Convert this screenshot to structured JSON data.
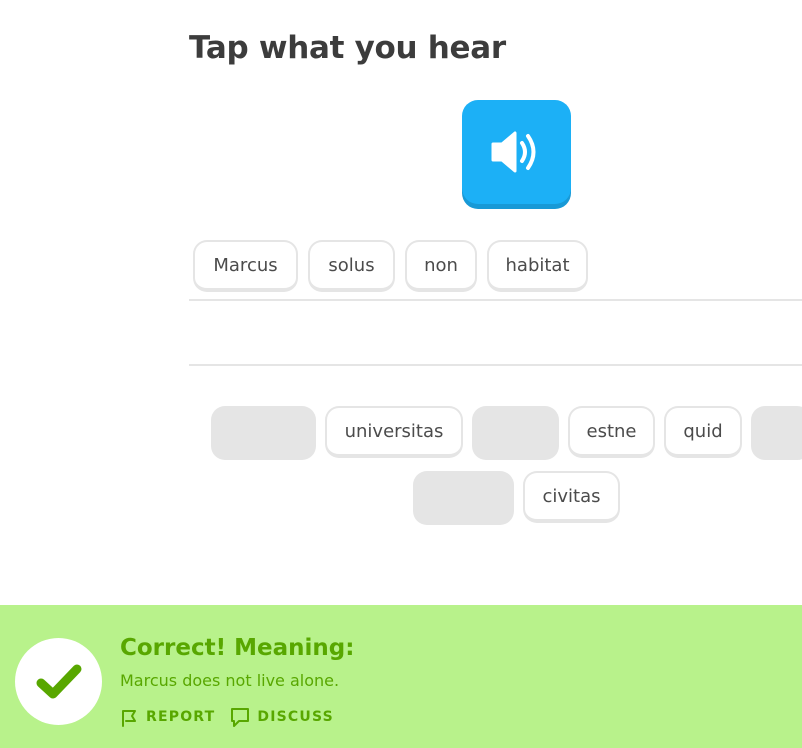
{
  "prompt": {
    "title": "Tap what you hear"
  },
  "audio": {
    "icon": "speaker-icon",
    "color": "#1cb0f6"
  },
  "answer": {
    "words": [
      "Marcus",
      "solus",
      "non",
      "habitat"
    ]
  },
  "word_bank": {
    "row1": [
      {
        "type": "slot"
      },
      {
        "type": "word",
        "label": "universitas"
      },
      {
        "type": "slot"
      },
      {
        "type": "word",
        "label": "estne"
      },
      {
        "type": "word",
        "label": "quid"
      },
      {
        "type": "slot"
      }
    ],
    "row2": [
      {
        "type": "slot"
      },
      {
        "type": "word",
        "label": "civitas"
      }
    ]
  },
  "feedback": {
    "title": "Correct! Meaning:",
    "meaning": "Marcus does not live alone.",
    "report_label": "REPORT",
    "discuss_label": "DISCUSS",
    "background_color": "#b8f28b",
    "accent_color": "#58a700",
    "icon": "checkmark-icon"
  }
}
